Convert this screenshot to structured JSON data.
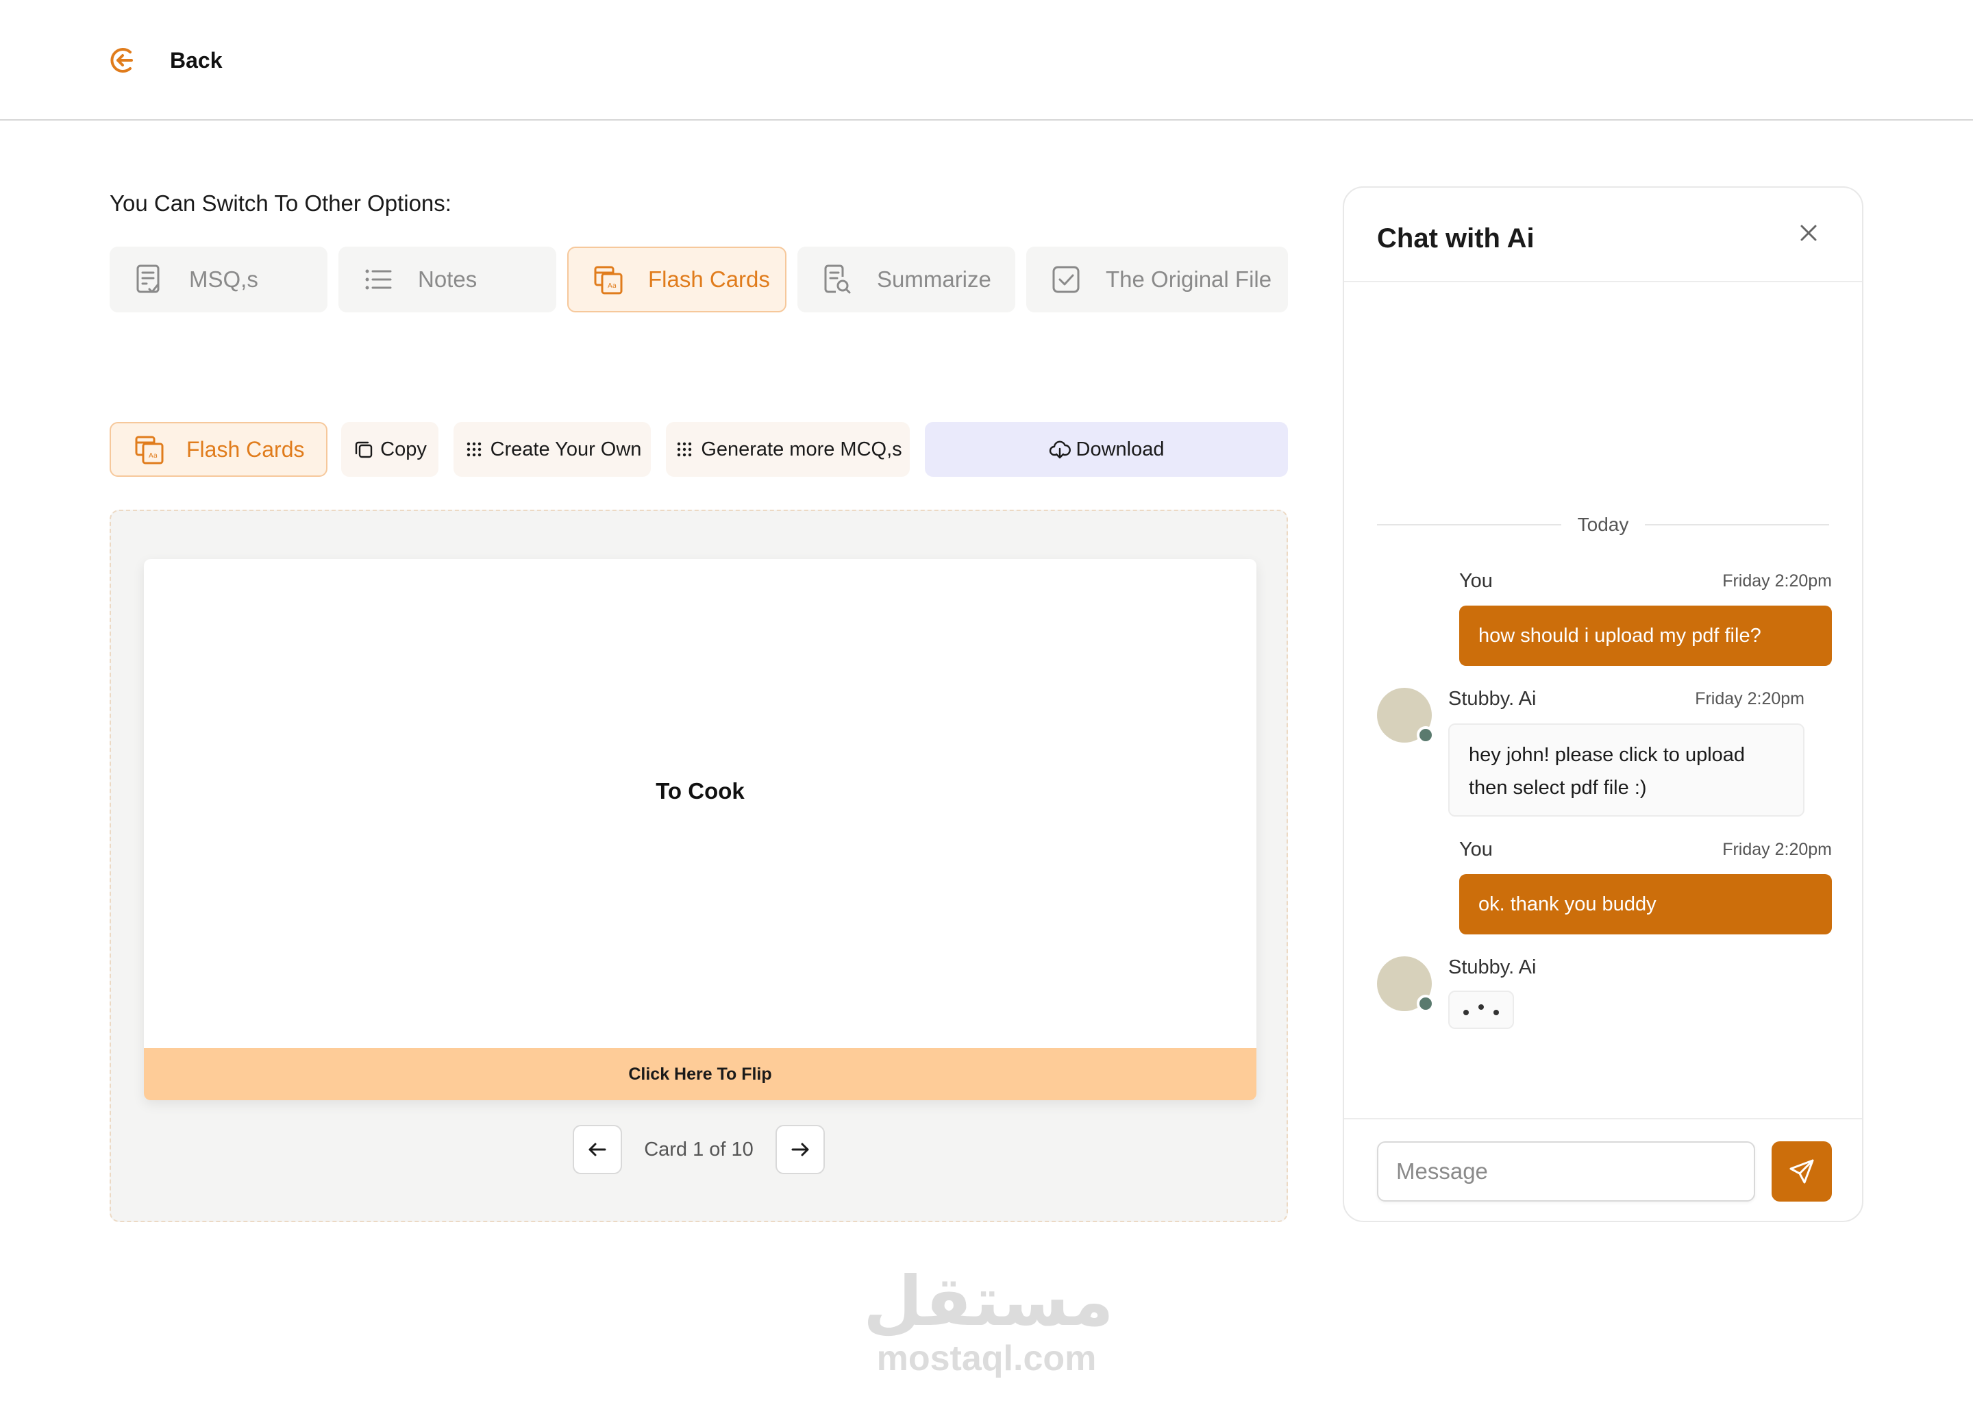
{
  "header": {
    "back_label": "Back"
  },
  "switcher": {
    "title": "You Can Switch To Other Options:",
    "options": [
      {
        "label": "MSQ,s",
        "icon": "checklist-doc-icon"
      },
      {
        "label": "Notes",
        "icon": "list-icon"
      },
      {
        "label": "Flash Cards",
        "icon": "flash-cards-icon",
        "active": true
      },
      {
        "label": "Summarize",
        "icon": "doc-search-icon"
      },
      {
        "label": "The Original File",
        "icon": "checkbox-icon"
      }
    ]
  },
  "toolbar": {
    "flash_cards": "Flash Cards",
    "copy": "Copy",
    "create_your_own": "Create Your Own",
    "generate_more": "Generate more MCQ,s",
    "download": "Download"
  },
  "card": {
    "word": "To Cook",
    "flip_label": "Click Here To Flip",
    "pager": "Card 1 of 10"
  },
  "chat": {
    "title": "Chat with Ai",
    "divider": "Today",
    "messages": [
      {
        "sender": "You",
        "time": "Friday 2:20pm",
        "text": "how should i upload my pdf file?"
      },
      {
        "sender": "Stubby. Ai",
        "time": "Friday 2:20pm",
        "text_line1": "hey john! please click to upload",
        "text_line2": "then select pdf file :)"
      },
      {
        "sender": "You",
        "time": "Friday 2:20pm",
        "text": "ok. thank you buddy"
      },
      {
        "sender": "Stubby. Ai"
      }
    ],
    "input_placeholder": "Message"
  },
  "watermark": {
    "arabic": "مستقل",
    "latin": "mostaql.com"
  },
  "colors": {
    "accent": "#e07c1c",
    "chat_bubble": "#cc6e0b",
    "flip_bar": "#fecc98",
    "download_bg": "#eaeafb",
    "avatar": "#d7d1bb",
    "online_dot": "#5a7a6e"
  }
}
